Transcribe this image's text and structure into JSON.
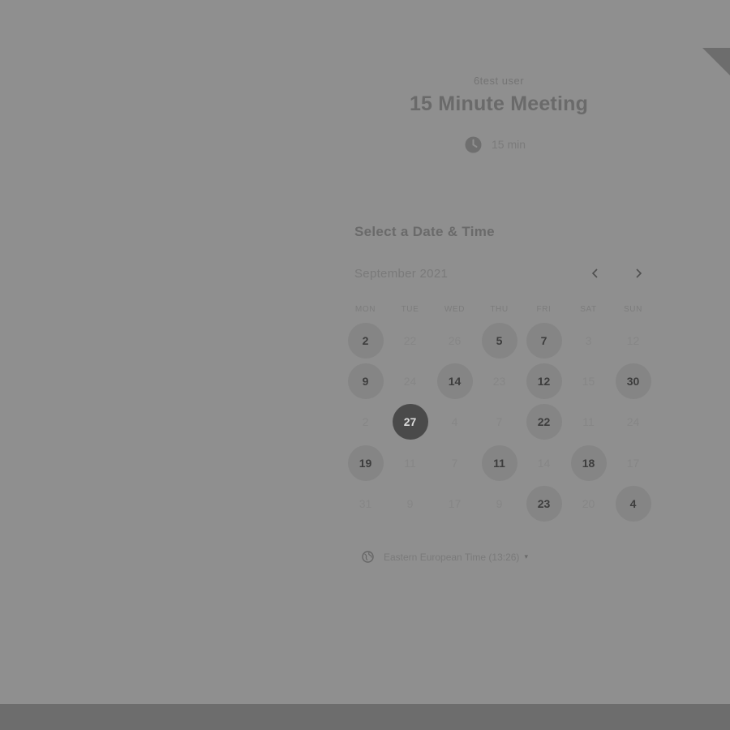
{
  "header": {
    "host_name": "6test user",
    "meeting_title": "15 Minute Meeting",
    "duration": "15 min"
  },
  "calendar": {
    "heading": "Select a Date & Time",
    "month_label": "September 2021",
    "prev_icon": "chevron-left-icon",
    "next_icon": "chevron-right-icon",
    "weekdays": [
      "MON",
      "TUE",
      "WED",
      "THU",
      "FRI",
      "SAT",
      "SUN"
    ],
    "days": [
      {
        "label": "2",
        "state": "available"
      },
      {
        "label": "22",
        "state": "disabled"
      },
      {
        "label": "26",
        "state": "disabled"
      },
      {
        "label": "5",
        "state": "available"
      },
      {
        "label": "7",
        "state": "available"
      },
      {
        "label": "3",
        "state": "disabled"
      },
      {
        "label": "12",
        "state": "disabled"
      },
      {
        "label": "9",
        "state": "available"
      },
      {
        "label": "24",
        "state": "disabled"
      },
      {
        "label": "14",
        "state": "available"
      },
      {
        "label": "23",
        "state": "disabled"
      },
      {
        "label": "12",
        "state": "available"
      },
      {
        "label": "15",
        "state": "disabled"
      },
      {
        "label": "30",
        "state": "available"
      },
      {
        "label": "2",
        "state": "disabled"
      },
      {
        "label": "27",
        "state": "selected"
      },
      {
        "label": "4",
        "state": "disabled"
      },
      {
        "label": "7",
        "state": "disabled"
      },
      {
        "label": "22",
        "state": "available"
      },
      {
        "label": "11",
        "state": "disabled"
      },
      {
        "label": "24",
        "state": "disabled"
      },
      {
        "label": "19",
        "state": "available"
      },
      {
        "label": "11",
        "state": "disabled"
      },
      {
        "label": "7",
        "state": "disabled"
      },
      {
        "label": "11",
        "state": "available"
      },
      {
        "label": "14",
        "state": "disabled"
      },
      {
        "label": "18",
        "state": "available"
      },
      {
        "label": "17",
        "state": "disabled"
      },
      {
        "label": "31",
        "state": "disabled"
      },
      {
        "label": "9",
        "state": "disabled"
      },
      {
        "label": "17",
        "state": "disabled"
      },
      {
        "label": "9",
        "state": "disabled"
      },
      {
        "label": "23",
        "state": "available"
      },
      {
        "label": "20",
        "state": "disabled"
      },
      {
        "label": "4",
        "state": "available"
      }
    ]
  },
  "timezone": {
    "label": "Eastern European Time (13:26)",
    "icon": "globe-icon",
    "caret": "▾"
  },
  "colors": {
    "overlay_background": "#8f8f8f",
    "bottom_bar": "#6d6d6d",
    "available_day": "#858585",
    "selected_day": "#4a4a4a"
  }
}
